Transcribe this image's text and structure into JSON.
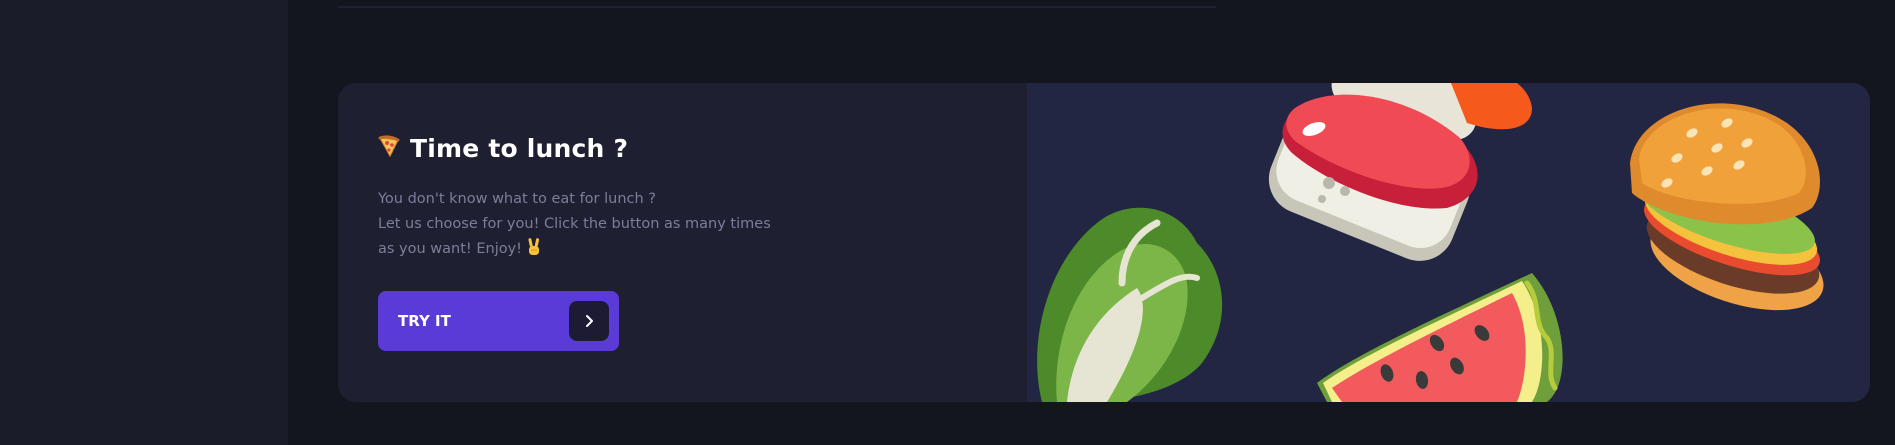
{
  "card": {
    "title": "Time to lunch ?",
    "title_icon": "pizza-icon",
    "description_lines": [
      "You don't know what to eat for lunch ?",
      "Let us choose for you! Click the button as many times",
      "as you want! Enjoy!"
    ],
    "description_emoji": "victory-hand-icon",
    "button_label": "TRY IT",
    "button_icon": "chevron-right-icon"
  },
  "illustration": {
    "items": [
      "lettuce-icon",
      "sushi-icon",
      "salmon-sushi-icon",
      "watermelon-icon",
      "burger-icon"
    ]
  },
  "colors": {
    "page_bg": "#14161f",
    "sidebar_bg": "#1a1c29",
    "card_bg": "#1e2031",
    "image_panel_bg": "#232643",
    "accent": "#5b3bd7",
    "title": "#ffffff",
    "description": "#7b7e98"
  }
}
